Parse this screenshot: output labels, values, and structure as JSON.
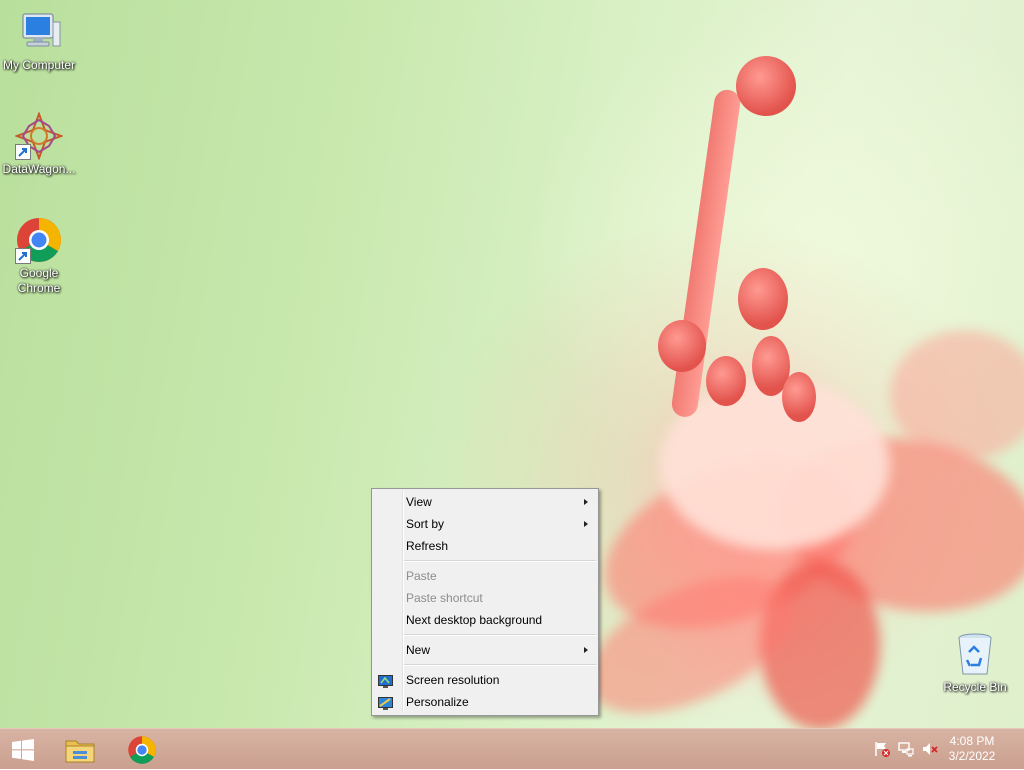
{
  "desktop": {
    "icons": [
      {
        "label": "My Computer",
        "icon": "computer-icon"
      },
      {
        "label": "DataWagon...",
        "icon": "datawagon-icon"
      },
      {
        "label": "Google Chrome",
        "icon": "chrome-icon"
      },
      {
        "label": "Recycle Bin",
        "icon": "recycle-bin-icon"
      }
    ]
  },
  "context_menu": {
    "items": [
      {
        "label": "View",
        "enabled": true,
        "submenu": true
      },
      {
        "label": "Sort by",
        "enabled": true,
        "submenu": true
      },
      {
        "label": "Refresh",
        "enabled": true
      },
      {
        "label": "Paste",
        "enabled": false
      },
      {
        "label": "Paste shortcut",
        "enabled": false
      },
      {
        "label": "Next desktop background",
        "enabled": true
      },
      {
        "label": "New",
        "enabled": true,
        "submenu": true
      },
      {
        "label": "Screen resolution",
        "enabled": true,
        "icon": "screen-resolution-icon"
      },
      {
        "label": "Personalize",
        "enabled": true,
        "icon": "personalize-icon"
      }
    ]
  },
  "taskbar": {
    "start_icon": "windows-logo-icon",
    "pinned": [
      "file-explorer-icon",
      "chrome-icon"
    ],
    "tray": [
      "action-center-flag-icon",
      "network-icon",
      "volume-muted-icon"
    ],
    "clock": {
      "time": "4:08 PM",
      "date": "3/2/2022"
    }
  },
  "colors": {
    "taskbar": "#caa090",
    "menu_bg": "#f0f0f0",
    "menu_disabled_text": "#8d8d8d",
    "accent_blue": "#1f6fd1"
  }
}
